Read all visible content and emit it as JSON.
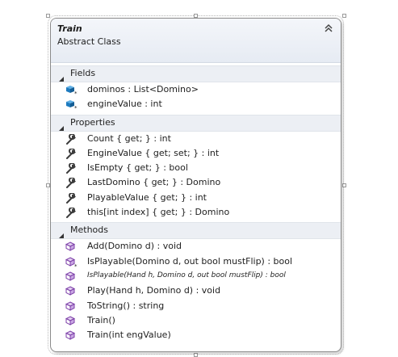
{
  "class": {
    "name": "Train",
    "stereotype": "Abstract Class",
    "collapse_icon": "double-chevron-up-icon"
  },
  "fields": {
    "label": "Fields",
    "items": [
      {
        "text": "dominos : List<Domino>",
        "icon": "private-field-icon"
      },
      {
        "text": "engineValue : int",
        "icon": "private-field-icon"
      }
    ]
  },
  "properties": {
    "label": "Properties",
    "items": [
      {
        "text": "Count { get; } : int",
        "icon": "wrench-property-icon"
      },
      {
        "text": "EngineValue { get; set; } : int",
        "icon": "wrench-property-icon"
      },
      {
        "text": "IsEmpty { get; } : bool",
        "icon": "wrench-property-icon"
      },
      {
        "text": "LastDomino { get; } : Domino",
        "icon": "wrench-property-icon"
      },
      {
        "text": "PlayableValue { get; } : int",
        "icon": "wrench-property-icon"
      },
      {
        "text": "this[int index] { get; } : Domino",
        "icon": "wrench-property-icon"
      }
    ]
  },
  "methods": {
    "label": "Methods",
    "items": [
      {
        "text": "Add(Domino d) : void",
        "icon": "method-cube-icon"
      },
      {
        "text": "IsPlayable(Domino d, out bool mustFlip) : bool",
        "icon": "private-method-cube-icon"
      },
      {
        "text": "IsPlayable(Hand h, Domino d, out bool mustFlip) : bool",
        "icon": "method-cube-icon",
        "style": "abstract-italic"
      },
      {
        "text": "Play(Hand h, Domino d) : void",
        "icon": "method-cube-icon"
      },
      {
        "text": "ToString() : string",
        "icon": "method-cube-icon"
      },
      {
        "text": "Train()",
        "icon": "method-cube-icon"
      },
      {
        "text": "Train(int engValue)",
        "icon": "method-cube-icon"
      }
    ]
  },
  "colors": {
    "field_icon": "#1e7bbf",
    "method_icon": "#7c3fa8",
    "wrench_icon": "#3c3c3c"
  }
}
